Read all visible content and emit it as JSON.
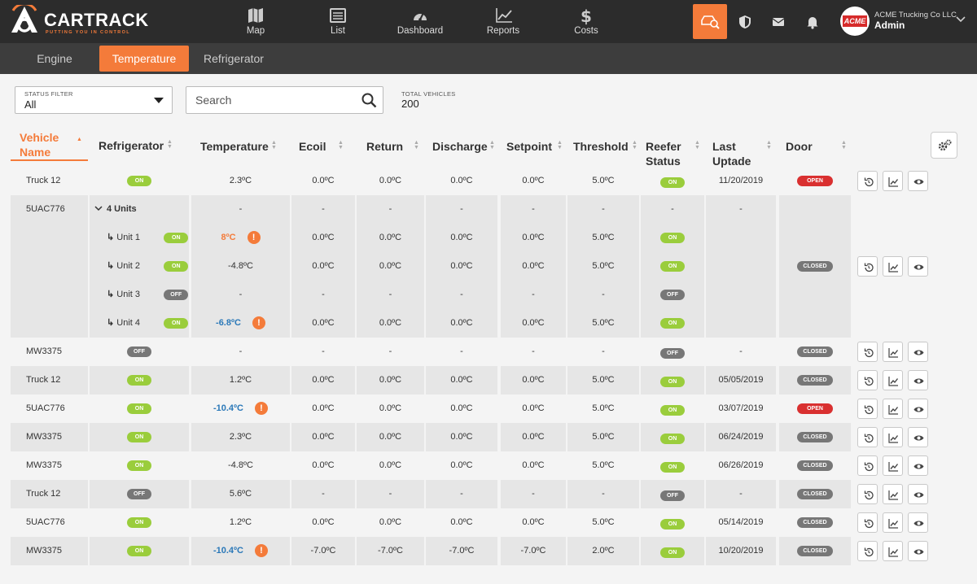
{
  "brand": {
    "name": "CARTRACK",
    "tagline": "PUTTING YOU IN CONTROL"
  },
  "nav": [
    {
      "label": "Map",
      "icon": "map-icon"
    },
    {
      "label": "List",
      "icon": "list-icon"
    },
    {
      "label": "Dashboard",
      "icon": "dashboard-icon"
    },
    {
      "label": "Reports",
      "icon": "reports-icon"
    },
    {
      "label": "Costs",
      "icon": "dollar-icon"
    }
  ],
  "user": {
    "avatar_text": "ACME",
    "company": "ACME Trucking Co LLC",
    "role": "Admin"
  },
  "tabs": [
    "Engine",
    "Temperature",
    "Refrigerator"
  ],
  "filters": {
    "status_label": "STATUS FILTER",
    "status_value": "All",
    "search_placeholder": "Search",
    "total_label": "TOTAL VEHICLES",
    "total_value": "200"
  },
  "columns": [
    "Vehicle Name",
    "Refrigerator",
    "Temperature",
    "Ecoil",
    "Return",
    "Discharge",
    "Setpoint",
    "Threshold",
    "Reefer Status",
    "Last Uptade",
    "Door"
  ],
  "colors": {
    "accent": "#f47b3a",
    "on": "#9acd3c",
    "off": "#777777",
    "open": "#d93030",
    "cold": "#2a78b8"
  },
  "rows": [
    {
      "name": "Truck 12",
      "fridge": "ON",
      "temp": "2.3ºC",
      "ecoil": "0.0ºC",
      "ret": "0.0ºC",
      "dis": "0.0ºC",
      "set": "0.0ºC",
      "thr": "5.0ºC",
      "reefer": "ON",
      "last": "11/20/2019",
      "door": "OPEN"
    },
    {
      "name": "5UAC776",
      "group": true,
      "units_label": "4 Units",
      "temp": "-",
      "ecoil": "-",
      "ret": "-",
      "dis": "-",
      "set": "-",
      "thr": "-",
      "reefer": "-",
      "last": "-",
      "door": "CLOSED",
      "units": [
        {
          "label": "Unit 1",
          "fridge": "ON",
          "temp": "8ºC",
          "temp_style": "orange",
          "warn": true,
          "ecoil": "0.0ºC",
          "ret": "0.0ºC",
          "dis": "0.0ºC",
          "set": "0.0ºC",
          "thr": "5.0ºC",
          "reefer": "ON"
        },
        {
          "label": "Unit 2",
          "fridge": "ON",
          "temp": "-4.8ºC",
          "ecoil": "0.0ºC",
          "ret": "0.0ºC",
          "dis": "0.0ºC",
          "set": "0.0ºC",
          "thr": "5.0ºC",
          "reefer": "ON"
        },
        {
          "label": "Unit 3",
          "fridge": "OFF",
          "temp": "-",
          "ecoil": "-",
          "ret": "-",
          "dis": "-",
          "set": "-",
          "thr": "-",
          "reefer": "OFF"
        },
        {
          "label": "Unit 4",
          "fridge": "ON",
          "temp": "-6.8ºC",
          "temp_style": "blue",
          "warn": true,
          "ecoil": "0.0ºC",
          "ret": "0.0ºC",
          "dis": "0.0ºC",
          "set": "0.0ºC",
          "thr": "5.0ºC",
          "reefer": "ON"
        }
      ]
    },
    {
      "name": "MW3375",
      "fridge": "OFF",
      "temp": "-",
      "ecoil": "-",
      "ret": "-",
      "dis": "-",
      "set": "-",
      "thr": "-",
      "reefer": "OFF",
      "last": "-",
      "door": "CLOSED"
    },
    {
      "name": "Truck 12",
      "fridge": "ON",
      "temp": "1.2ºC",
      "ecoil": "0.0ºC",
      "ret": "0.0ºC",
      "dis": "0.0ºC",
      "set": "0.0ºC",
      "thr": "5.0ºC",
      "reefer": "ON",
      "last": "05/05/2019",
      "door": "CLOSED"
    },
    {
      "name": "5UAC776",
      "fridge": "ON",
      "temp": "-10.4ºC",
      "temp_style": "blue",
      "warn": true,
      "ecoil": "0.0ºC",
      "ret": "0.0ºC",
      "dis": "0.0ºC",
      "set": "0.0ºC",
      "thr": "5.0ºC",
      "reefer": "ON",
      "last": "03/07/2019",
      "door": "OPEN"
    },
    {
      "name": "MW3375",
      "fridge": "ON",
      "temp": "2.3ºC",
      "ecoil": "0.0ºC",
      "ret": "0.0ºC",
      "dis": "0.0ºC",
      "set": "0.0ºC",
      "thr": "5.0ºC",
      "reefer": "ON",
      "last": "06/24/2019",
      "door": "CLOSED"
    },
    {
      "name": "MW3375",
      "fridge": "ON",
      "temp": "-4.8ºC",
      "ecoil": "0.0ºC",
      "ret": "0.0ºC",
      "dis": "0.0ºC",
      "set": "0.0ºC",
      "thr": "5.0ºC",
      "reefer": "ON",
      "last": "06/26/2019",
      "door": "CLOSED"
    },
    {
      "name": "Truck 12",
      "fridge": "OFF",
      "temp": "5.6ºC",
      "ecoil": "-",
      "ret": "-",
      "dis": "-",
      "set": "-",
      "thr": "-",
      "reefer": "OFF",
      "last": "-",
      "door": "CLOSED"
    },
    {
      "name": "5UAC776",
      "fridge": "ON",
      "temp": "1.2ºC",
      "ecoil": "0.0ºC",
      "ret": "0.0ºC",
      "dis": "0.0ºC",
      "set": "0.0ºC",
      "thr": "5.0ºC",
      "reefer": "ON",
      "last": "05/14/2019",
      "door": "CLOSED"
    },
    {
      "name": "MW3375",
      "fridge": "ON",
      "temp": "-10.4ºC",
      "temp_style": "blue",
      "warn": true,
      "ecoil": "-7.0ºC",
      "ret": "-7.0ºC",
      "dis": "-7.0ºC",
      "set": "-7.0ºC",
      "thr": "2.0ºC",
      "reefer": "ON",
      "last": "10/20/2019",
      "door": "CLOSED"
    }
  ],
  "row_actions": [
    "history-icon",
    "chart-icon",
    "eye-icon"
  ]
}
